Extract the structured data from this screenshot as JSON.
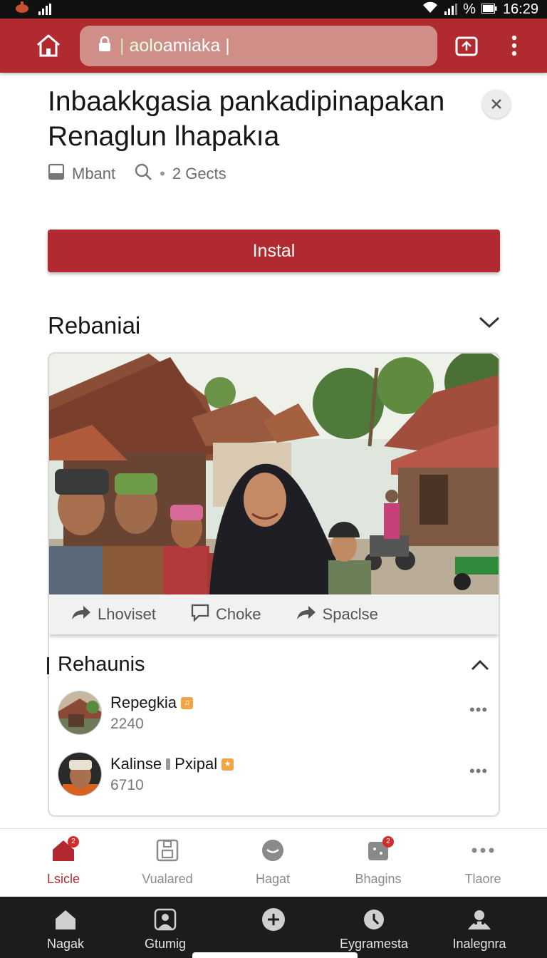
{
  "status_bar": {
    "time": "16:29",
    "battery_label": "%"
  },
  "browser": {
    "url_prefix": "aolo",
    "url_rest": "amiaka",
    "cursor": "|"
  },
  "app": {
    "title": "Inbaakkgasia pankadipinapakan Renaglun lhapakıa",
    "meta_author": "Mbant",
    "meta_count": "2 Gects",
    "install_label": "Instal"
  },
  "section1": {
    "title": "Rebaniai",
    "actions": [
      {
        "label": "Lhoviset",
        "icon": "share-icon"
      },
      {
        "label": "Choke",
        "icon": "comment-icon"
      },
      {
        "label": "Spaclse",
        "icon": "share-icon"
      }
    ]
  },
  "section2": {
    "title": "Rehaunis",
    "items": [
      {
        "name": "Repegkia",
        "count": "2240",
        "tag": "♫"
      },
      {
        "name": "Kalinse",
        "name_extra": "Pxipal",
        "count": "6710",
        "tag": "★"
      }
    ]
  },
  "tabs": [
    {
      "label": "Lsicle",
      "icon": "home-icon",
      "badge": "2"
    },
    {
      "label": "Vualared",
      "icon": "save-icon"
    },
    {
      "label": "Hagat",
      "icon": "face-icon"
    },
    {
      "label": "Bhagins",
      "icon": "chat-icon",
      "badge": "2"
    },
    {
      "label": "Tlaore",
      "icon": "more-icon"
    }
  ],
  "nav": [
    {
      "label": "Nagak",
      "icon": "home-icon"
    },
    {
      "label": "Gtumig",
      "icon": "profile-icon"
    },
    {
      "label": "",
      "icon": "add-icon"
    },
    {
      "label": "Eygramesta",
      "icon": "clock-icon"
    },
    {
      "label": "Inalegnra",
      "icon": "group-icon"
    }
  ],
  "colors": {
    "brand": "#b02a30",
    "url_bar": "#cf8f88",
    "nav_bg": "#1c1c1c"
  }
}
